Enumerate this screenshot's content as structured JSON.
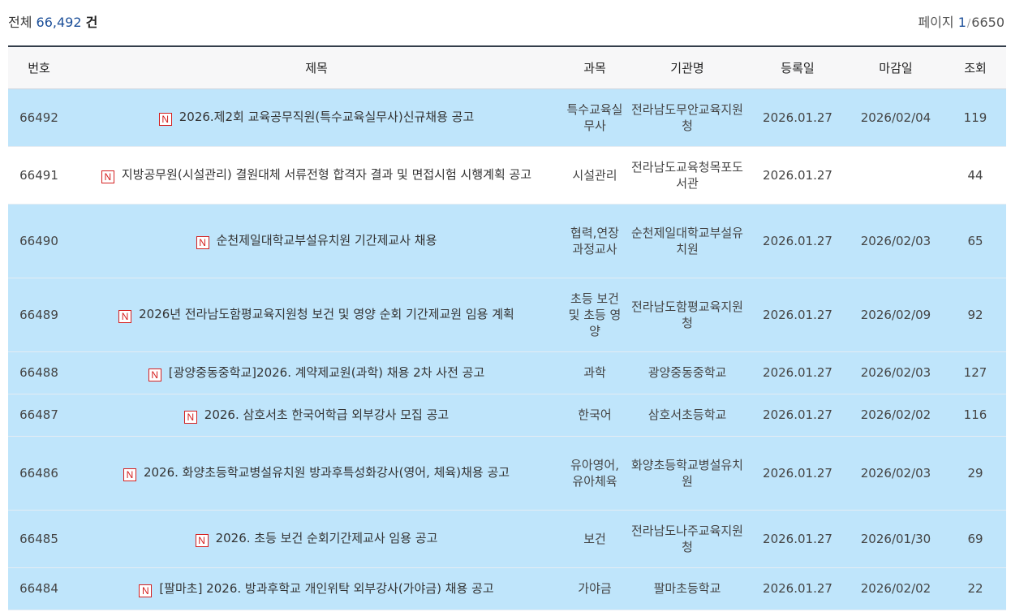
{
  "summary": {
    "total_label": "전체",
    "total_count": "66,492",
    "total_unit": "건"
  },
  "pager": {
    "label": "페이지",
    "current": "1",
    "separator": "/",
    "total": "6650"
  },
  "table": {
    "headers": {
      "no": "번호",
      "title": "제목",
      "subject": "과목",
      "org": "기관명",
      "reg_date": "등록일",
      "deadline": "마감일",
      "views": "조회"
    },
    "badge": "N",
    "rows": [
      {
        "no": "66492",
        "title": "2026.제2회 교육공무직원(특수교육실무사)신규채용 공고",
        "subject": "특수교육실무사",
        "org": "전라남도무안교육지원청",
        "reg_date": "2026.01.27",
        "deadline": "2026/02/04",
        "views": "119"
      },
      {
        "no": "66491",
        "title": "지방공무원(시설관리) 결원대체 서류전형 합격자 결과 및 면접시험 시행계획 공고",
        "subject": "시설관리",
        "org": "전라남도교육청목포도서관",
        "reg_date": "2026.01.27",
        "deadline": "",
        "views": "44"
      },
      {
        "no": "66490",
        "title": "순천제일대학교부설유치원 기간제교사 채용",
        "subject": "협력,연장과정교사",
        "org": "순천제일대학교부설유치원",
        "reg_date": "2026.01.27",
        "deadline": "2026/02/03",
        "views": "65"
      },
      {
        "no": "66489",
        "title": "2026년 전라남도함평교육지원청 보건 및 영양 순회 기간제교원 임용 계획",
        "subject": "초등 보건 및 초등 영양",
        "org": "전라남도함평교육지원청",
        "reg_date": "2026.01.27",
        "deadline": "2026/02/09",
        "views": "92"
      },
      {
        "no": "66488",
        "title": "[광양중동중학교]2026. 계약제교원(과학) 채용 2차 사전 공고",
        "subject": "과학",
        "org": "광양중동중학교",
        "reg_date": "2026.01.27",
        "deadline": "2026/02/03",
        "views": "127"
      },
      {
        "no": "66487",
        "title": "2026. 삼호서초 한국어학급 외부강사 모집 공고",
        "subject": "한국어",
        "org": "삼호서초등학교",
        "reg_date": "2026.01.27",
        "deadline": "2026/02/02",
        "views": "116"
      },
      {
        "no": "66486",
        "title": "2026. 화양초등학교병설유치원 방과후특성화강사(영어, 체육)채용 공고",
        "subject": "유아영어, 유아체육",
        "org": "화양초등학교병설유치원",
        "reg_date": "2026.01.27",
        "deadline": "2026/02/03",
        "views": "29"
      },
      {
        "no": "66485",
        "title": "2026. 초등 보건 순회기간제교사 임용 공고",
        "subject": "보건",
        "org": "전라남도나주교육지원청",
        "reg_date": "2026.01.27",
        "deadline": "2026/01/30",
        "views": "69"
      },
      {
        "no": "66484",
        "title": "[팔마초] 2026. 방과후학교 개인위탁 외부강사(가야금) 채용 공고",
        "subject": "가야금",
        "org": "팔마초등학교",
        "reg_date": "2026.01.27",
        "deadline": "2026/02/02",
        "views": "22"
      }
    ]
  }
}
